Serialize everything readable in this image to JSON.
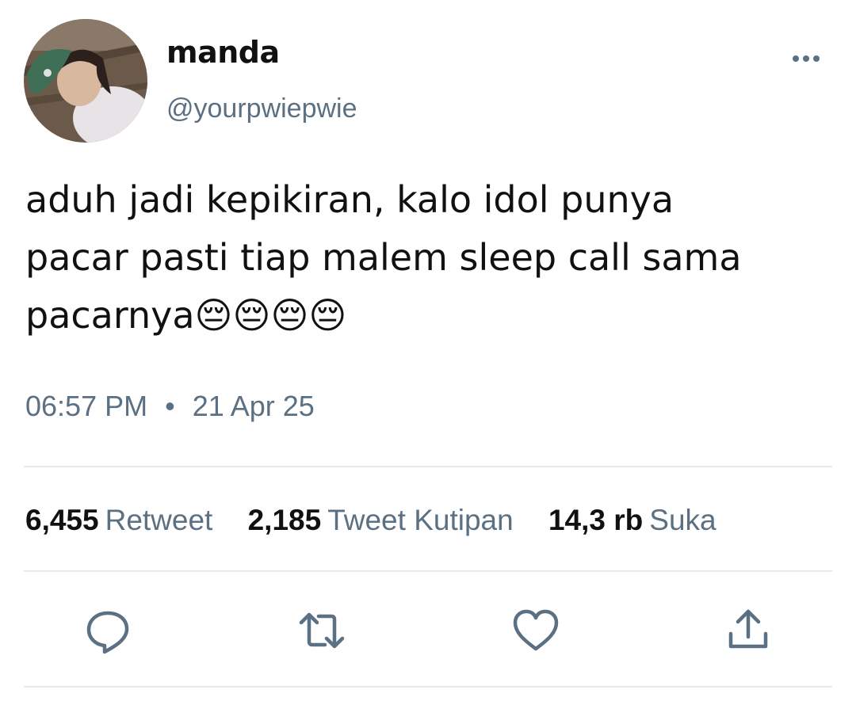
{
  "user": {
    "display_name": "manda",
    "handle": "@yourpwiepwie"
  },
  "tweet": {
    "text": "aduh jadi kepikiran, kalo idol punya\npacar pasti tiap malem sleep call sama\npacarnya😔😔😔😔",
    "time": "06:57 PM",
    "separator": "•",
    "date": "21 Apr 25"
  },
  "stats": {
    "retweets_count": "6,455",
    "retweets_label": "Retweet",
    "quotes_count": "2,185",
    "quotes_label": "Tweet Kutipan",
    "likes_count": "14,3 rb",
    "likes_label": "Suka"
  },
  "actions": [
    "reply-icon",
    "retweet-icon",
    "like-icon",
    "share-icon"
  ],
  "colors": {
    "text": "#111111",
    "secondary": "#5b7083",
    "divider": "#e7e9ea"
  }
}
